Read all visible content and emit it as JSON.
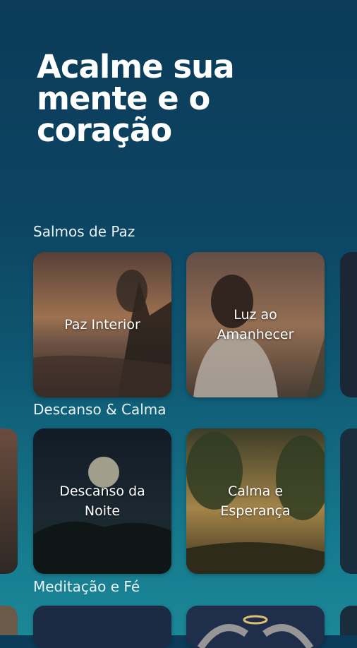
{
  "header": {
    "title": "Acalme sua mente e o coração"
  },
  "sections": [
    {
      "label": "Salmos de Paz",
      "cards": [
        {
          "label": "Paz Interior"
        },
        {
          "label": "Luz ao Amanhecer"
        }
      ]
    },
    {
      "label": "Descanso & Calma",
      "cards": [
        {
          "label": "Descanso da Noite"
        },
        {
          "label": "Calma e Esperança"
        }
      ]
    },
    {
      "label": "Meditação e Fé",
      "cards": []
    }
  ],
  "colors": {
    "background_top": "#0b3b58",
    "background_bottom": "#1b8797",
    "text": "#ffffff"
  }
}
